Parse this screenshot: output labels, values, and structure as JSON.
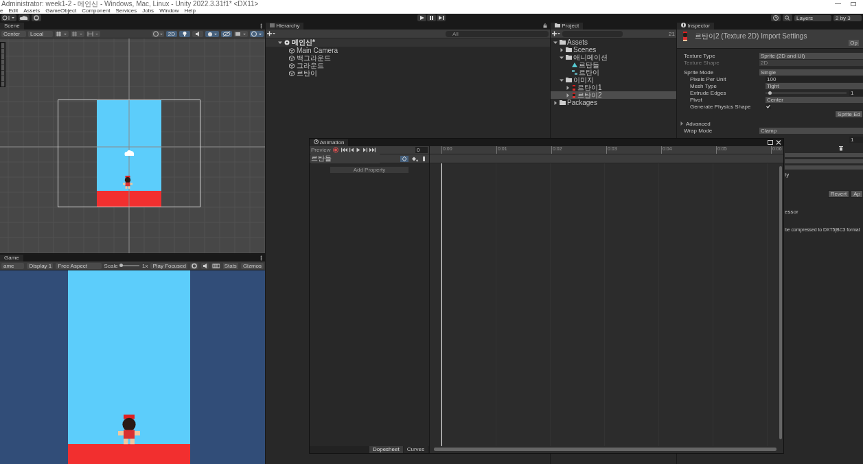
{
  "title_bar": {
    "title": "Administrator: week1-2 - 메인신 - Windows, Mac, Linux - Unity 2022.3.31f1* <DX11>"
  },
  "menu": [
    "e",
    "Edit",
    "Assets",
    "GameObject",
    "Component",
    "Services",
    "Jobs",
    "Window",
    "Help"
  ],
  "toolbar": {
    "layers": "Layers",
    "layout": "2 by 3"
  },
  "scene": {
    "tab": "Scene",
    "pivot": "Center",
    "space": "Local",
    "mode_2d": "2D",
    "mode_2d_on": true
  },
  "game": {
    "tab": "Game",
    "mode": "ame",
    "display": "Display 1",
    "aspect": "Free Aspect",
    "scale_label": "Scale",
    "scale_slider": {
      "level": 0.02
    },
    "scale": "1x",
    "play_mode": "Play Focused",
    "stats": "Stats",
    "gizmos": "Gizmos"
  },
  "hierarchy": {
    "tab": "Hierarchy",
    "search_placeholder": "All",
    "scene": {
      "label": "메인신*",
      "expanded": true,
      "children": [
        {
          "label": "Main Camera"
        },
        {
          "label": "백그라운드"
        },
        {
          "label": "그라운드"
        },
        {
          "label": "르탄이"
        }
      ]
    }
  },
  "project": {
    "tab": "Project",
    "count": "21",
    "tree": [
      {
        "label": "Assets",
        "kind": "folder",
        "expanded": true,
        "selected": false,
        "children": [
          {
            "label": "Scenes",
            "kind": "folder",
            "expanded": false,
            "selected": false
          },
          {
            "label": "애니메이션",
            "kind": "folder",
            "expanded": true,
            "selected": false,
            "children": [
              {
                "label": "르탄들",
                "kind": "clip",
                "selected": false
              },
              {
                "label": "르탄이",
                "kind": "controller",
                "selected": false
              }
            ]
          },
          {
            "label": "이미지",
            "kind": "folder",
            "expanded": true,
            "selected": false,
            "children": [
              {
                "label": "르탄이1",
                "kind": "sprite",
                "expanded": false,
                "selected": false
              },
              {
                "label": "르탄이2",
                "kind": "sprite",
                "expanded": false,
                "selected": true
              }
            ]
          }
        ]
      },
      {
        "label": "Packages",
        "kind": "folder",
        "expanded": false,
        "selected": false
      }
    ]
  },
  "inspector": {
    "tab": "Inspector",
    "header": "르탄이2 (Texture 2D) Import Settings",
    "open_button": "Op",
    "rows": [
      {
        "kind": "dropdown",
        "label": "Texture Type",
        "value": "Sprite (2D and UI)",
        "disabled": false
      },
      {
        "kind": "dropdown",
        "label": "Texture Shape",
        "value": "2D",
        "disabled": true
      },
      {
        "kind": "dropdown",
        "label": "Sprite Mode",
        "value": "Single",
        "disabled": false,
        "children": [
          {
            "kind": "field",
            "label": "Pixels Per Unit",
            "value": "100",
            "disabled": false
          },
          {
            "kind": "dropdown",
            "label": "Mesh Type",
            "value": "Tight",
            "disabled": false
          },
          {
            "kind": "slider",
            "label": "Extrude Edges",
            "level": 0.03,
            "value": "1",
            "disabled": false
          },
          {
            "kind": "dropdown",
            "label": "Pivot",
            "value": "Center",
            "disabled": false
          },
          {
            "kind": "checkbox",
            "label": "Generate Physics Shape",
            "checked": true,
            "disabled": false
          }
        ]
      }
    ],
    "sprite_editor_button": "Sprite Ed",
    "advanced": {
      "label": "Advanced",
      "expanded": false
    },
    "wrap_mode": {
      "label": "Wrap Mode",
      "value": "Clamp"
    },
    "hidden_slider_value": "1",
    "hidden_dropdown_value": "ty",
    "revert_button": "Revert",
    "apply_button": "Ap",
    "format_text": "essor",
    "message": "be compressed to DXT5|BC3 format"
  },
  "animation": {
    "tab": "Animation",
    "preview": "Preview",
    "frame": "0",
    "clip": "르탄들",
    "add_property": "Add Property",
    "ticks": [
      "0:00",
      "0:01",
      "0:02",
      "0:03",
      "0:04",
      "0:05",
      "0:06"
    ],
    "bottom_tabs": [
      {
        "label": "Dopesheet",
        "selected": true
      },
      {
        "label": "Curves",
        "selected": false
      }
    ]
  }
}
